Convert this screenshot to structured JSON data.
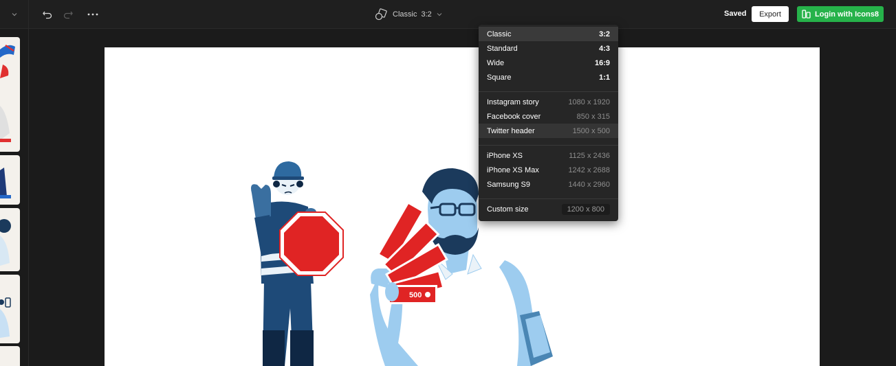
{
  "topbar": {
    "ratio_name": "Classic",
    "ratio_value": "3:2",
    "saved_label": "Saved",
    "export_label": "Export",
    "login_label": "Login with Icons8"
  },
  "menu": {
    "presets": [
      {
        "label": "Classic",
        "value": "3:2"
      },
      {
        "label": "Standard",
        "value": "4:3"
      },
      {
        "label": "Wide",
        "value": "16:9"
      },
      {
        "label": "Square",
        "value": "1:1"
      }
    ],
    "social": [
      {
        "label": "Instagram story",
        "value": "1080 x 1920"
      },
      {
        "label": "Facebook cover",
        "value": "850 x 315"
      },
      {
        "label": "Twitter header",
        "value": "1500 x 500"
      }
    ],
    "devices": [
      {
        "label": "iPhone XS",
        "value": "1125 x 2436"
      },
      {
        "label": "iPhone XS Max",
        "value": "1242 x 2688"
      },
      {
        "label": "Samsung S9",
        "value": "1440 x 2960"
      }
    ],
    "custom": {
      "label": "Custom size",
      "value": "1200 x 800"
    }
  },
  "illustration": {
    "banknote_label": "500"
  },
  "colors": {
    "accent_green": "#26b24a",
    "stop_red": "#e02424",
    "worker_navy": "#1e4a78",
    "light_blue": "#9dccef"
  }
}
